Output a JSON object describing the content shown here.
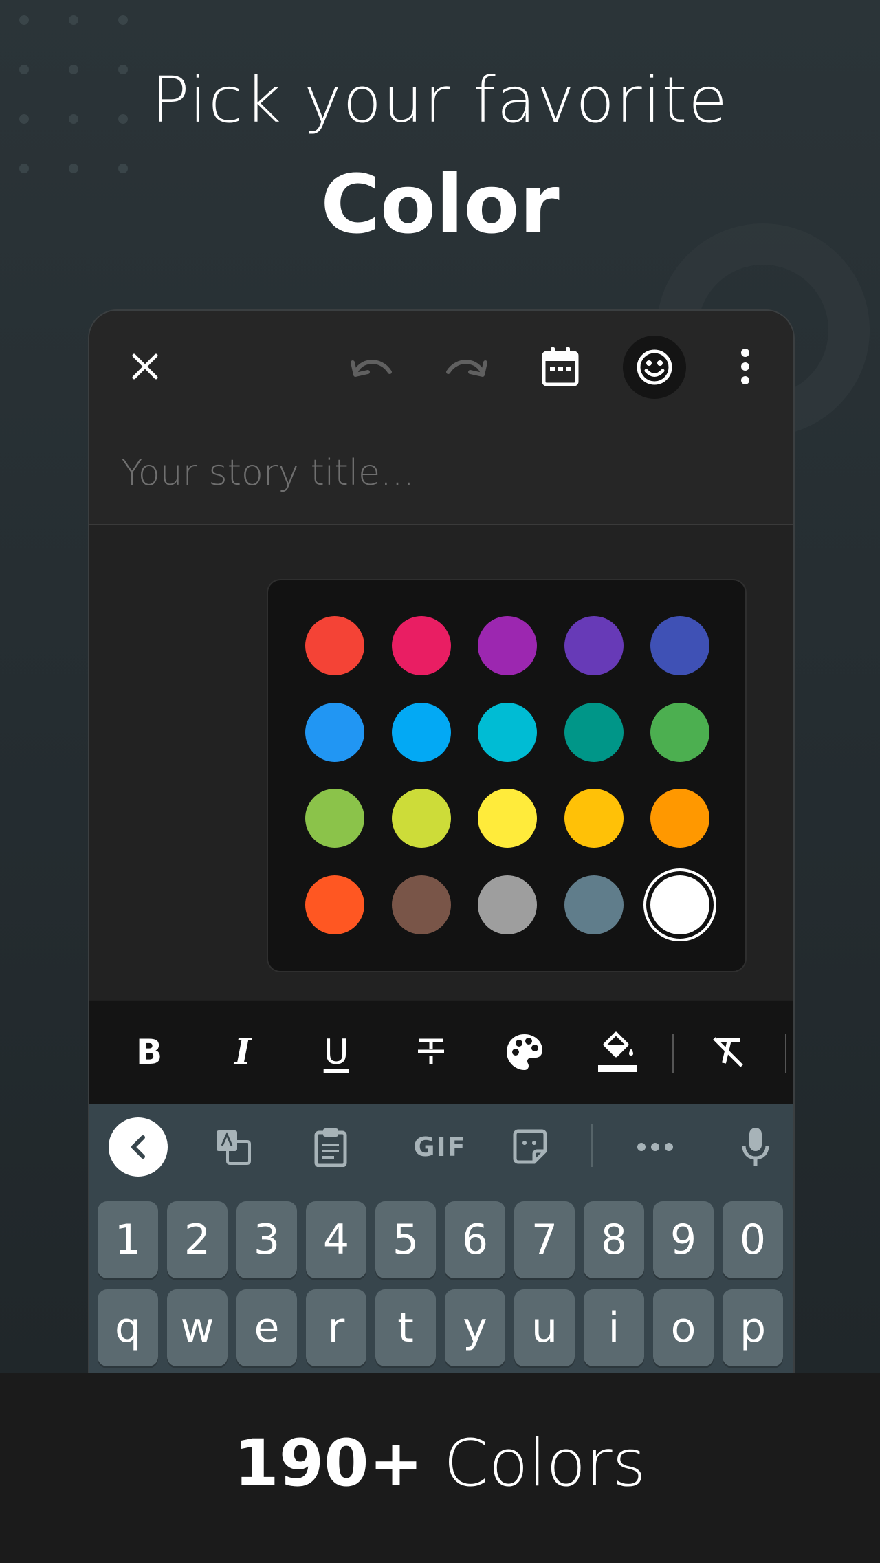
{
  "hero": {
    "line1": "Pick your favorite",
    "line2": "Color"
  },
  "toolbar": {
    "close_icon": "close-icon",
    "undo_icon": "undo-icon",
    "redo_icon": "redo-icon",
    "calendar_icon": "calendar-icon",
    "emoji_icon": "emoji-icon",
    "more_icon": "more-vert-icon"
  },
  "editor": {
    "title_placeholder": "Your story title..."
  },
  "palette": {
    "colors": [
      "#f44336",
      "#e91e63",
      "#9c27b0",
      "#673ab7",
      "#3f51b5",
      "#2196f3",
      "#03a9f4",
      "#00bcd4",
      "#009688",
      "#4caf50",
      "#8bc34a",
      "#cddc39",
      "#ffeb3b",
      "#ffc107",
      "#ff9800",
      "#ff5722",
      "#795548",
      "#9e9e9e",
      "#607d8b",
      "#ffffff"
    ],
    "selected_index": 19
  },
  "format_bar": {
    "bold": "B",
    "italic": "I",
    "underline": "U"
  },
  "keyboard": {
    "gif_label": "GIF",
    "number_row": [
      "1",
      "2",
      "3",
      "4",
      "5",
      "6",
      "7",
      "8",
      "9",
      "0"
    ],
    "letter_row": [
      "q",
      "w",
      "e",
      "r",
      "t",
      "y",
      "u",
      "i",
      "o",
      "p"
    ]
  },
  "footer": {
    "count": "190+",
    "label": "Colors"
  }
}
